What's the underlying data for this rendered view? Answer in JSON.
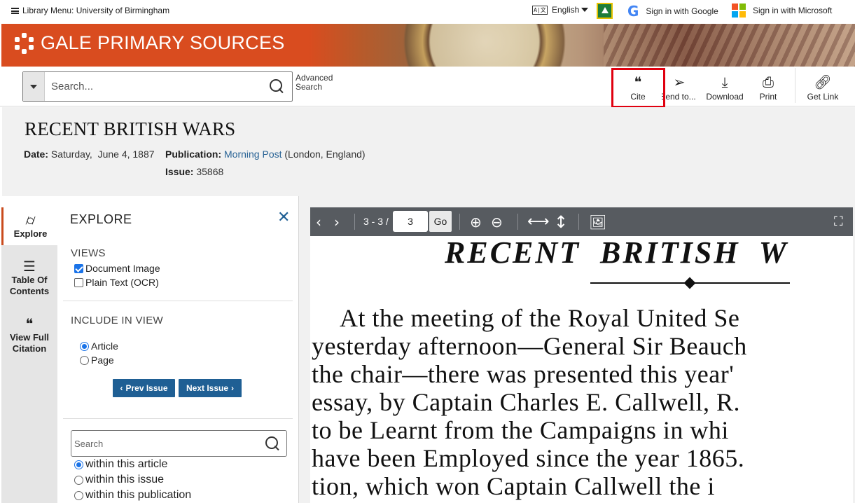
{
  "topbar": {
    "library_menu": "Library Menu: University of Birmingham",
    "language": "English",
    "language_icon": "translate-icon",
    "sign_in_google": "Sign in with Google",
    "sign_in_microsoft": "Sign in with Microsoft"
  },
  "banner": {
    "brand": "GALE PRIMARY SOURCES",
    "brand_color": "#d94c1f"
  },
  "search": {
    "placeholder": "Search...",
    "advanced_search": "Advanced Search"
  },
  "toolbar": {
    "cite": "Cite",
    "send_to": "Send to...",
    "download": "Download",
    "print": "Print",
    "get_link": "Get Link",
    "highlight_color": "#e0000f"
  },
  "document": {
    "title": "RECENT BRITISH WARS",
    "date_label": "Date:",
    "date_value": "Saturday,  June 4, 1887",
    "publication_label": "Publication:",
    "publication_link": "Morning Post",
    "publication_place": "(London, England)",
    "issue_label": "Issue:",
    "issue_value": "35868"
  },
  "rail": {
    "explore": "Explore",
    "toc_line1": "Table Of",
    "toc_line2": "Contents",
    "citation_line1": "View Full",
    "citation_line2": "Citation",
    "active_color": "#c94a1c"
  },
  "explore": {
    "title": "EXPLORE",
    "views_heading": "VIEWS",
    "view_document_image": "Document Image",
    "view_plain_text": "Plain Text (OCR)",
    "include_heading": "INCLUDE IN VIEW",
    "include_article": "Article",
    "include_page": "Page",
    "prev_issue": "Prev Issue",
    "next_issue": "Next Issue",
    "search_placeholder": "Search",
    "scope_article": "within this article",
    "scope_issue": "within this issue",
    "scope_publication": "within this publication",
    "button_color": "#1f5f94"
  },
  "viewer": {
    "page_range": "3 - 3 /",
    "page_input": "3",
    "go": "Go",
    "scan_title": "RECENT  BRITISH  W",
    "scan_lines": [
      "At the meeting of the Royal United Se",
      "yesterday afternoon—General Sir Beauch",
      "the chair—there was presented this year'",
      "essay, by Captain Charles E. Callwell, R.",
      "to be Learnt from the Campaigns in whi",
      "have been Employed since the year 1865.",
      "tion, which won Captain Callwell the i"
    ],
    "toolbar_color": "#575b60"
  }
}
